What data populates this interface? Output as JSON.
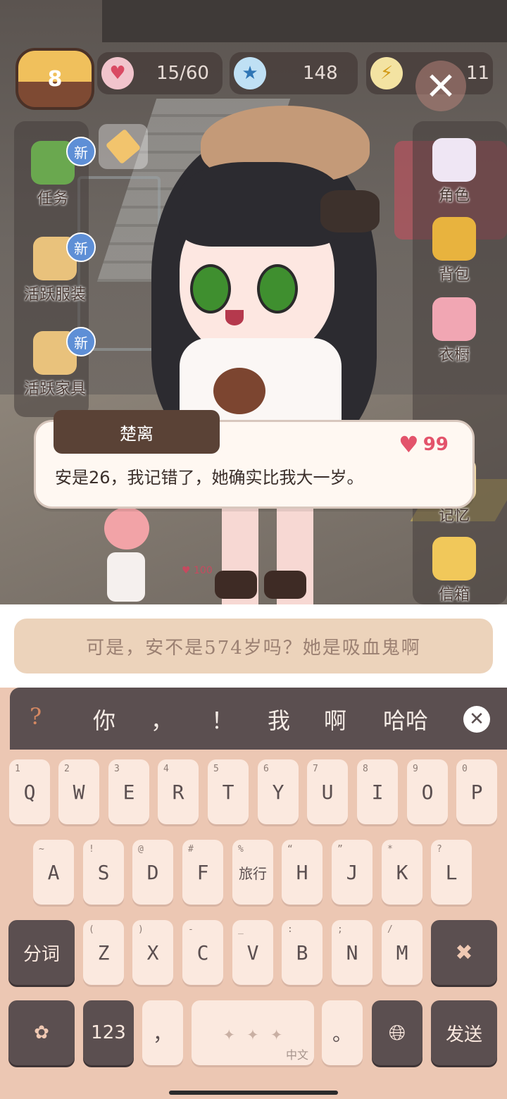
{
  "hud": {
    "level": "8",
    "hearts": "15/60",
    "stars": "148",
    "energy": "11"
  },
  "left_menu": [
    {
      "label": "任务",
      "badge": "新"
    },
    {
      "label": "活跃服装",
      "badge": "新"
    },
    {
      "label": "活跃家具",
      "badge": "新"
    }
  ],
  "right_menu": [
    {
      "label": "角色"
    },
    {
      "label": "背包"
    },
    {
      "label": "衣橱"
    },
    {
      "label": "记忆"
    },
    {
      "label": "信箱"
    }
  ],
  "dialog": {
    "speaker": "楚离",
    "text": "安是26，我记错了，她确实比我大一岁。",
    "affinity": "99"
  },
  "npc": {
    "hearts": "100"
  },
  "reply": {
    "text": "可是，安不是574岁吗？她是吸血鬼啊"
  },
  "keyboard": {
    "candidates": [
      "?",
      "你",
      "，",
      "！",
      "我",
      "啊",
      "哈哈"
    ],
    "row1": [
      {
        "k": "Q",
        "s": "1"
      },
      {
        "k": "W",
        "s": "2"
      },
      {
        "k": "E",
        "s": "3"
      },
      {
        "k": "R",
        "s": "4"
      },
      {
        "k": "T",
        "s": "5"
      },
      {
        "k": "Y",
        "s": "6"
      },
      {
        "k": "U",
        "s": "7"
      },
      {
        "k": "I",
        "s": "8"
      },
      {
        "k": "O",
        "s": "9"
      },
      {
        "k": "P",
        "s": "0"
      }
    ],
    "row2": [
      {
        "k": "A",
        "s": "~"
      },
      {
        "k": "S",
        "s": "!"
      },
      {
        "k": "D",
        "s": "@"
      },
      {
        "k": "F",
        "s": "#"
      },
      {
        "k": "旅行",
        "s": "%"
      },
      {
        "k": "H",
        "s": "“"
      },
      {
        "k": "J",
        "s": "”"
      },
      {
        "k": "K",
        "s": "*"
      },
      {
        "k": "L",
        "s": "?"
      }
    ],
    "row3": [
      {
        "k": "Z",
        "s": "("
      },
      {
        "k": "X",
        "s": ")"
      },
      {
        "k": "C",
        "s": "-"
      },
      {
        "k": "V",
        "s": "_"
      },
      {
        "k": "B",
        "s": ":"
      },
      {
        "k": "N",
        "s": ";"
      },
      {
        "k": "M",
        "s": "/"
      }
    ],
    "split": "分词",
    "num": "123",
    "comma": "，",
    "period": "。",
    "space_hint": "中文",
    "send": "发送"
  },
  "colors": {
    "accent": "#5b4f50",
    "key_bg": "#fbe9df",
    "keyboard_bg": "#ecc7b3",
    "reply_bg": "#ecd3bb"
  }
}
